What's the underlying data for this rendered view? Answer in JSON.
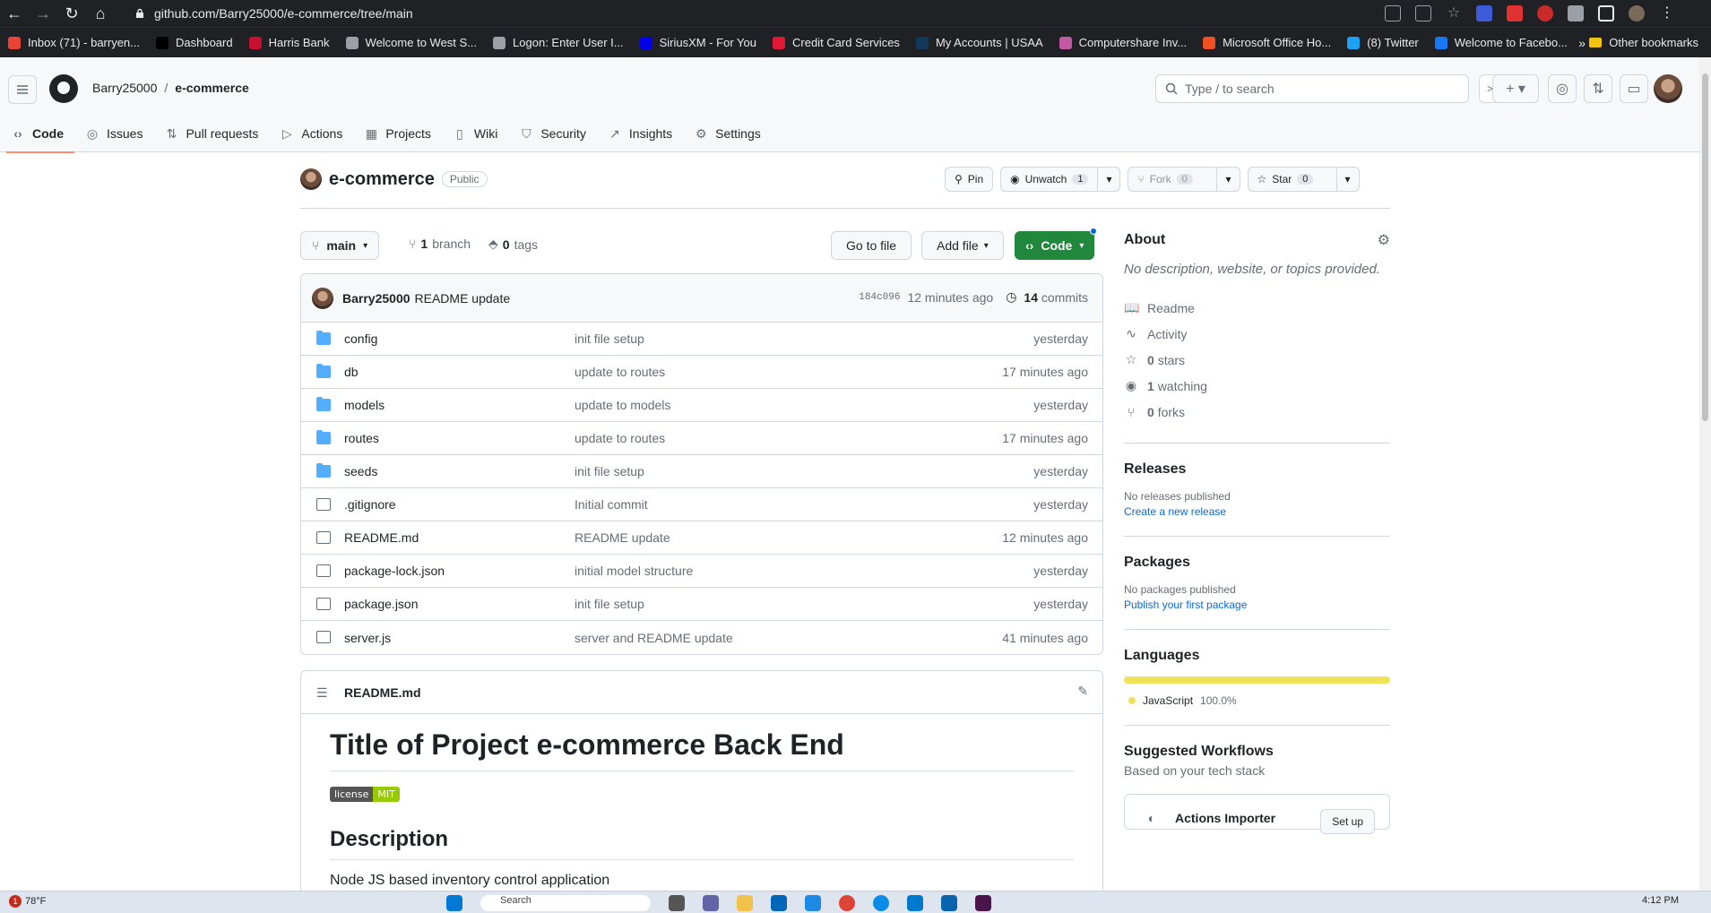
{
  "browser": {
    "url": "github.com/Barry25000/e-commerce/tree/main",
    "bookmarks": [
      {
        "label": "Inbox (71) - barryen...",
        "color": "#ea4335"
      },
      {
        "label": "Dashboard",
        "color": "#000000"
      },
      {
        "label": "Harris Bank",
        "color": "#c8102e"
      },
      {
        "label": "Welcome to West S...",
        "color": "#9aa0a6"
      },
      {
        "label": "Logon: Enter User I...",
        "color": "#9aa0a6"
      },
      {
        "label": "SiriusXM - For You",
        "color": "#0000eb"
      },
      {
        "label": "Credit Card Services",
        "color": "#e31837"
      },
      {
        "label": "My Accounts | USAA",
        "color": "#12385b"
      },
      {
        "label": "Computershare Inv...",
        "color": "#c45aa6"
      },
      {
        "label": "Microsoft Office Ho...",
        "color": "#f25022"
      },
      {
        "label": "(8) Twitter",
        "color": "#1da1f2"
      },
      {
        "label": "Welcome to Facebo...",
        "color": "#1877f2"
      }
    ],
    "more": "»",
    "other_bookmarks": "Other bookmarks"
  },
  "header": {
    "owner": "Barry25000",
    "separator": "/",
    "repo": "e-commerce",
    "search_placeholder": "Type / to search",
    "tabs": [
      {
        "label": "Code",
        "icon": "‹›",
        "name": "tab-code"
      },
      {
        "label": "Issues",
        "icon": "◎",
        "name": "tab-issues"
      },
      {
        "label": "Pull requests",
        "icon": "⇅",
        "name": "tab-pull-requests"
      },
      {
        "label": "Actions",
        "icon": "▷",
        "name": "tab-actions"
      },
      {
        "label": "Projects",
        "icon": "▦",
        "name": "tab-projects"
      },
      {
        "label": "Wiki",
        "icon": "▯",
        "name": "tab-wiki"
      },
      {
        "label": "Security",
        "icon": "⛉",
        "name": "tab-security"
      },
      {
        "label": "Insights",
        "icon": "↗",
        "name": "tab-insights"
      },
      {
        "label": "Settings",
        "icon": "⚙",
        "name": "tab-settings"
      }
    ]
  },
  "repo": {
    "name": "e-commerce",
    "visibility": "Public",
    "pin": "Pin",
    "unwatch": "Unwatch",
    "watch_count": "1",
    "fork": "Fork",
    "fork_count": "0",
    "star": "Star",
    "star_count": "0"
  },
  "file_nav": {
    "branch": "main",
    "branches_count": "1",
    "branches_label": "branch",
    "tags_count": "0",
    "tags_label": "tags",
    "go_to_file": "Go to file",
    "add_file": "Add file",
    "code": "Code"
  },
  "commit": {
    "author": "Barry25000",
    "message": "README update",
    "sha": "184c096",
    "age": "12 minutes ago",
    "commits_count": "14",
    "commits_label": "commits"
  },
  "files": [
    {
      "name": "config",
      "type": "folder",
      "message": "init file setup",
      "age": "yesterday"
    },
    {
      "name": "db",
      "type": "folder",
      "message": "update to routes",
      "age": "17 minutes ago"
    },
    {
      "name": "models",
      "type": "folder",
      "message": "update to models",
      "age": "yesterday"
    },
    {
      "name": "routes",
      "type": "folder",
      "message": "update to routes",
      "age": "17 minutes ago"
    },
    {
      "name": "seeds",
      "type": "folder",
      "message": "init file setup",
      "age": "yesterday"
    },
    {
      "name": ".gitignore",
      "type": "file",
      "message": "Initial commit",
      "age": "yesterday"
    },
    {
      "name": "README.md",
      "type": "file",
      "message": "README update",
      "age": "12 minutes ago"
    },
    {
      "name": "package-lock.json",
      "type": "file",
      "message": "initial model structure",
      "age": "yesterday"
    },
    {
      "name": "package.json",
      "type": "file",
      "message": "init file setup",
      "age": "yesterday"
    },
    {
      "name": "server.js",
      "type": "file",
      "message": "server and README update",
      "age": "41 minutes ago"
    }
  ],
  "readme": {
    "filename": "README.md",
    "title": "Title of Project e-commerce Back End",
    "badge_left": "license",
    "badge_right": "MIT",
    "section": "Description",
    "text": "Node JS based inventory control application"
  },
  "sidebar": {
    "about": "About",
    "description": "No description, website, or topics provided.",
    "items": [
      {
        "icon": "📖",
        "count": "",
        "label": "Readme"
      },
      {
        "icon": "∿",
        "count": "",
        "label": "Activity"
      },
      {
        "icon": "☆",
        "count": "0",
        "label": "stars"
      },
      {
        "icon": "◉",
        "count": "1",
        "label": "watching"
      },
      {
        "icon": "⑂",
        "count": "0",
        "label": "forks"
      }
    ],
    "releases_title": "Releases",
    "releases_text": "No releases published",
    "releases_link": "Create a new release",
    "packages_title": "Packages",
    "packages_text": "No packages published",
    "packages_link": "Publish your first package",
    "languages_title": "Languages",
    "language_name": "JavaScript",
    "language_pct": "100.0%",
    "language_fraction": 1.0,
    "language_color": "#f1e05a",
    "workflows_title": "Suggested Workflows",
    "workflows_sub": "Based on your tech stack",
    "workflow_name": "Actions Importer",
    "workflow_btn": "Set up"
  },
  "taskbar": {
    "notif_count": "1",
    "weather": "78°F",
    "search": "Search",
    "time": "4:12 PM"
  }
}
